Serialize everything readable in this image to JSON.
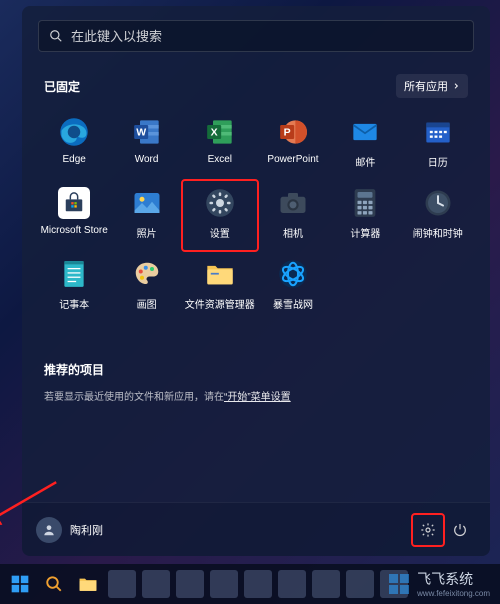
{
  "search": {
    "placeholder": "在此键入以搜索"
  },
  "pinned": {
    "header": "已固定",
    "all_apps_label": "所有应用",
    "apps": [
      {
        "name": "Edge"
      },
      {
        "name": "Word"
      },
      {
        "name": "Excel"
      },
      {
        "name": "PowerPoint"
      },
      {
        "name": "邮件"
      },
      {
        "name": "日历"
      },
      {
        "name": "Microsoft Store"
      },
      {
        "name": "照片"
      },
      {
        "name": "设置"
      },
      {
        "name": "相机"
      },
      {
        "name": "计算器"
      },
      {
        "name": "闹钟和时钟"
      },
      {
        "name": "记事本"
      },
      {
        "name": "画图"
      },
      {
        "name": "文件资源管理器"
      },
      {
        "name": "暴雪战网"
      }
    ]
  },
  "recommended": {
    "header": "推荐的项目",
    "tip_prefix": "若要显示最近使用的文件和新应用，请在",
    "tip_link": "“开始”菜单设置",
    "tip_suffix": ""
  },
  "user": {
    "name": "陶利刚"
  },
  "watermark": {
    "brand": "飞飞系统",
    "url": "www.fefeixitong.com"
  }
}
